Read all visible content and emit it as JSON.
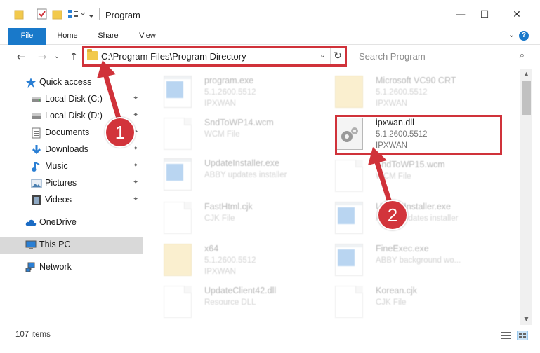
{
  "window": {
    "title": "Program",
    "minimize": "—",
    "maximize": "☐",
    "close": "✕"
  },
  "ribbon": {
    "tabs": [
      "File",
      "Home",
      "Share",
      "View"
    ],
    "help": "?",
    "collapse": "⌄"
  },
  "nav": {
    "back": "←",
    "forward": "→",
    "recent": "⌄",
    "up": "↑"
  },
  "address": {
    "path": "C:\\Program Files\\Program Directory",
    "dropdown": "⌄",
    "refresh": "↻"
  },
  "search": {
    "placeholder": "Search Program",
    "icon": "⌕"
  },
  "sidebar": {
    "items": [
      {
        "label": "Quick access",
        "icon": "star-icon",
        "pinned": false
      },
      {
        "label": "Local Disk (C:)",
        "icon": "drive-icon",
        "pinned": true
      },
      {
        "label": "Local Disk (D:)",
        "icon": "drive-icon",
        "pinned": true
      },
      {
        "label": "Documents",
        "icon": "documents-icon",
        "pinned": true
      },
      {
        "label": "Downloads",
        "icon": "download-icon",
        "pinned": true
      },
      {
        "label": "Music",
        "icon": "music-icon",
        "pinned": true
      },
      {
        "label": "Pictures",
        "icon": "pictures-icon",
        "pinned": true
      },
      {
        "label": "Videos",
        "icon": "videos-icon",
        "pinned": true
      },
      {
        "label": "OneDrive",
        "icon": "cloud-icon",
        "pinned": false
      },
      {
        "label": "This PC",
        "icon": "computer-icon",
        "pinned": false
      },
      {
        "label": "Network",
        "icon": "network-icon",
        "pinned": false
      }
    ],
    "pin_glyph": "📌"
  },
  "files": [
    {
      "name": "program.exe",
      "line1": "5.1.2600.5512",
      "line2": "IPXWAN",
      "icon": "application-icon",
      "faded": true
    },
    {
      "name": "Microsoft VC90 CRT",
      "line1": "5.1.2600.5512",
      "line2": "IPXWAN",
      "icon": "folder-icon",
      "faded": true
    },
    {
      "name": "SndToWP14.wcm",
      "line1": "WCM File",
      "line2": "",
      "icon": "document-icon",
      "faded": true
    },
    {
      "name": "ipxwan.dll",
      "line1": "5.1.2600.5512",
      "line2": "IPXWAN",
      "icon": "dll-gear-icon",
      "faded": false
    },
    {
      "name": "UpdateInstaller.exe",
      "line1": "ABBY updates installer",
      "line2": "",
      "icon": "window-app-icon",
      "faded": true
    },
    {
      "name": "SndToWP15.wcm",
      "line1": "WCM File",
      "line2": "",
      "icon": "document-icon",
      "faded": true
    },
    {
      "name": "FastHtml.cjk",
      "line1": "CJK File",
      "line2": "",
      "icon": "document-icon",
      "faded": true
    },
    {
      "name": "UpdateInstaller.exe",
      "line1": "ABBY updates installer",
      "line2": "",
      "icon": "window-app-icon",
      "faded": true
    },
    {
      "name": "x64",
      "line1": "5.1.2600.5512",
      "line2": "IPXWAN",
      "icon": "folder-icon",
      "faded": true
    },
    {
      "name": "FineExec.exe",
      "line1": "ABBY background wo...",
      "line2": "",
      "icon": "window-app-icon",
      "faded": true
    },
    {
      "name": "UpdateClient42.dll",
      "line1": "Resource DLL",
      "line2": "",
      "icon": "document-icon",
      "faded": true
    },
    {
      "name": "Korean.cjk",
      "line1": "CJK File",
      "line2": "",
      "icon": "document-icon",
      "faded": true
    }
  ],
  "markers": [
    "1",
    "2"
  ],
  "status": {
    "count": "107 items"
  },
  "colors": {
    "accent": "#1979ca",
    "highlight": "#d0323a",
    "marker": "#d2343b"
  }
}
